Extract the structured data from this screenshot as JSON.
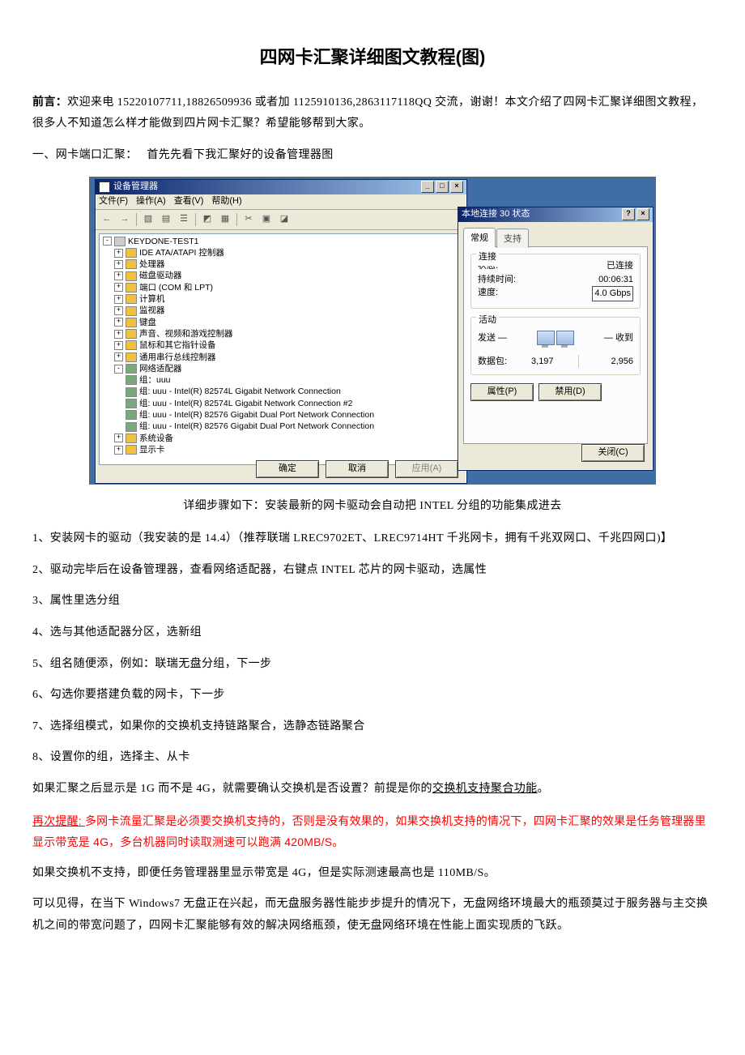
{
  "title": "四网卡汇聚详细图文教程(图)",
  "preface_label": "前言：",
  "preface_text": "欢迎来电 15220107711,18826509936 或者加 1125910136,2863117118QQ 交流，谢谢！本文介绍了四网卡汇聚详细图文教程，很多人不知道怎么样才能做到四片网卡汇聚？希望能够帮到大家。",
  "section_1_label": "一、网卡端口汇聚：",
  "section_1_lead": "首先先看下我汇聚好的设备管理器图",
  "screenshot": {
    "devmgr": {
      "title": "设备管理器",
      "menu": [
        "文件(F)",
        "操作(A)",
        "查看(V)",
        "帮助(H)"
      ],
      "root": "KEYDONE-TEST1",
      "nodes": [
        {
          "pm": "+",
          "ic": "",
          "label": "IDE ATA/ATAPI 控制器"
        },
        {
          "pm": "+",
          "ic": "",
          "label": "处理器"
        },
        {
          "pm": "+",
          "ic": "",
          "label": "磁盘驱动器"
        },
        {
          "pm": "+",
          "ic": "",
          "label": "端口 (COM 和 LPT)"
        },
        {
          "pm": "+",
          "ic": "",
          "label": "计算机"
        },
        {
          "pm": "+",
          "ic": "",
          "label": "监视器"
        },
        {
          "pm": "+",
          "ic": "",
          "label": "键盘"
        },
        {
          "pm": "+",
          "ic": "",
          "label": "声音、视频和游戏控制器"
        },
        {
          "pm": "+",
          "ic": "",
          "label": "鼠标和其它指针设备"
        },
        {
          "pm": "+",
          "ic": "",
          "label": "通用串行总线控制器"
        }
      ],
      "net_node": {
        "pm": "-",
        "label": "网络适配器",
        "children": [
          "组：uuu",
          "组: uuu - Intel(R) 82574L Gigabit Network Connection",
          "组: uuu - Intel(R) 82574L Gigabit Network Connection #2",
          "组: uuu - Intel(R) 82576 Gigabit Dual Port Network Connection",
          "组: uuu - Intel(R) 82576 Gigabit Dual Port Network Connection"
        ]
      },
      "tail_nodes": [
        {
          "pm": "+",
          "label": "系统设备"
        },
        {
          "pm": "+",
          "label": "显示卡"
        }
      ],
      "buttons": {
        "ok": "确定",
        "cancel": "取消",
        "apply": "应用(A)"
      }
    },
    "status": {
      "title": "本地连接 30 状态",
      "tabs": [
        "常规",
        "支持"
      ],
      "conn_group": "连接",
      "conn": [
        {
          "k": "状态:",
          "v": "已连接"
        },
        {
          "k": "持续时间:",
          "v": "00:06:31"
        },
        {
          "k": "速度:",
          "v": "4.0 Gbps",
          "highlight": true
        }
      ],
      "act_group": "活动",
      "act_labels": {
        "send": "发送 —",
        "recv": "— 收到"
      },
      "packets": {
        "label": "数据包:",
        "sent": "3,197",
        "recv": "2,956"
      },
      "buttons": {
        "prop": "属性(P)",
        "disable": "禁用(D)",
        "close": "关闭(C)"
      }
    }
  },
  "caption": "详细步骤如下：安装最新的网卡驱动会自动把 INTEL 分组的功能集成进去",
  "steps": [
    "1、安装网卡的驱动（我安装的是 14.4）（推荐联瑞 LREC9702ET、LREC9714HT 千兆网卡，拥有千兆双网口、千兆四网口)】",
    "2、驱动完毕后在设备管理器，查看网络适配器，右键点 INTEL 芯片的网卡驱动，选属性",
    "3、属性里选分组",
    "4、选与其他适配器分区，选新组",
    "5、组名随便添，例如：联瑞无盘分组，下一步",
    "6、勾选你要搭建负载的网卡，下一步",
    "7、选择组模式，如果你的交换机支持链路聚合，选静态链路聚合",
    "8、设置你的组，选择主、从卡"
  ],
  "after_steps_prefix": "如果汇聚之后显示是 1G 而不是 4G，就需要确认交换机是否设置？前提是你的",
  "after_steps_underline": "交换机支持聚合功能",
  "after_steps_suffix": "。",
  "red_para_pfx": "再次提醒: ",
  "red_para_body": "多网卡流量汇聚是必须要交换机支持的，否则是没有效果的，如果交换机支持的情况下，四网卡汇聚的效果是任务管理器里显示带宽是 4G，多台机器同时读取测速可以跑满 420MB/S。",
  "black_para_1": "如果交换机不支持，即便任务管理器里显示带宽是 4G，但是实际测速最高也是 110MB/S。",
  "black_para_2": "可以见得，在当下 Windows7 无盘正在兴起，而无盘服务器性能步步提升的情况下，无盘网络环境最大的瓶颈莫过于服务器与主交换机之间的带宽问题了，四网卡汇聚能够有效的解决网络瓶颈，使无盘网络环境在性能上面实现质的飞跃。"
}
